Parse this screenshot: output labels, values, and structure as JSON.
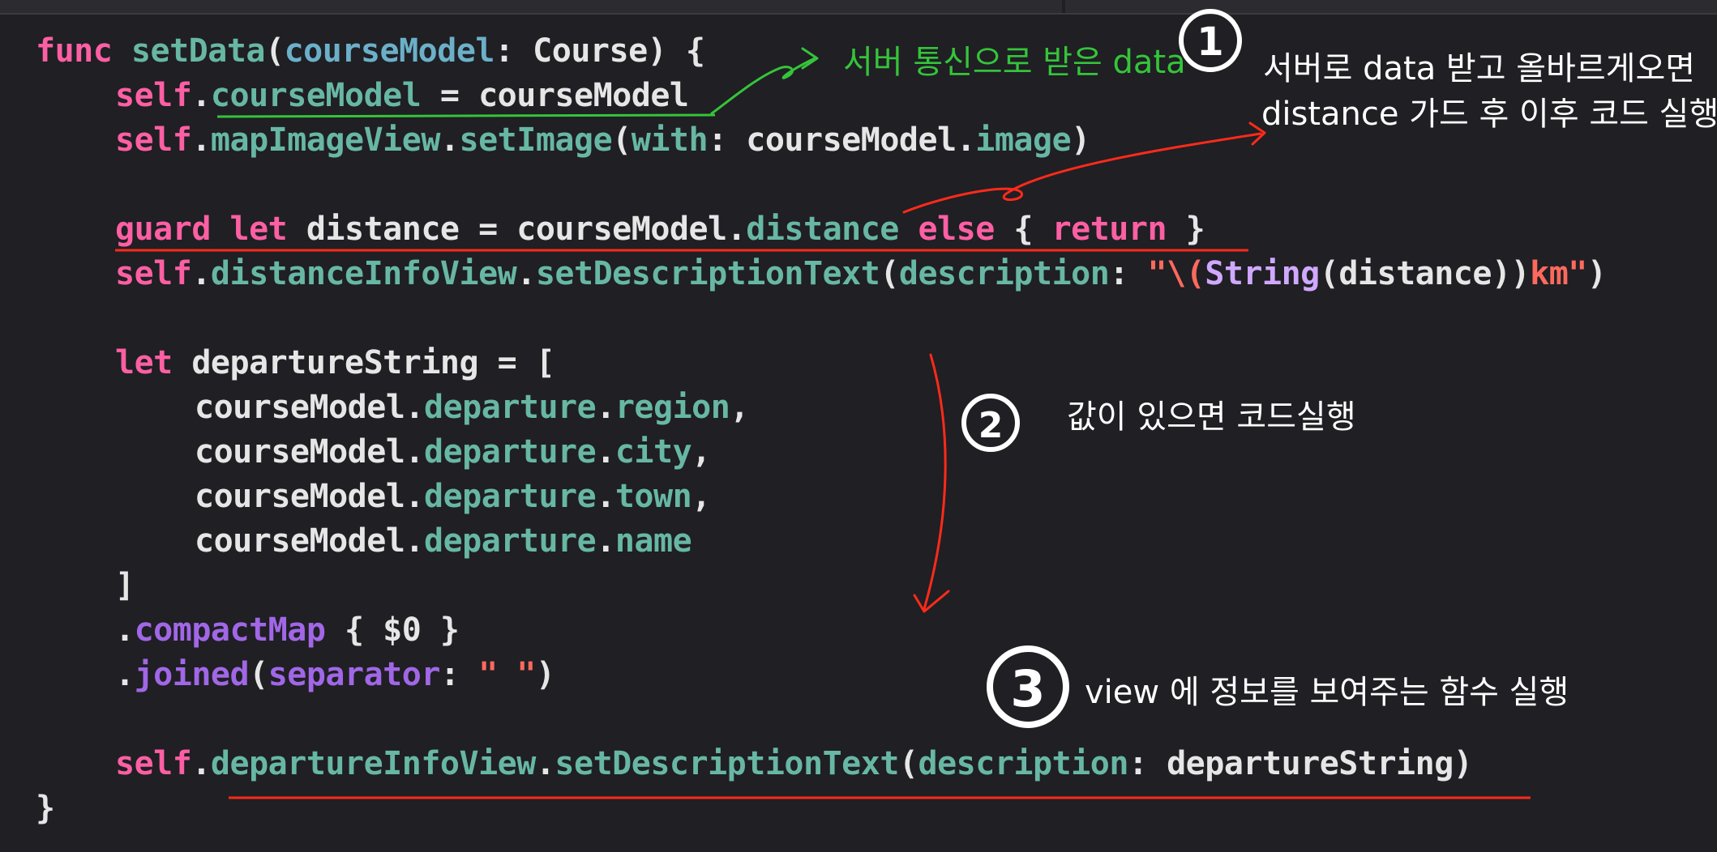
{
  "colors": {
    "background": "#1f1f24",
    "keyword": "#fc5fa3",
    "function": "#67b7a4",
    "type": "#d0a8ff",
    "string": "#fc6a5d",
    "annotation_red": "#ff2a1a",
    "annotation_green": "#35c43a"
  },
  "code": {
    "l1": {
      "kw": "func",
      "name": "setData",
      "open": "(",
      "param": "courseModel",
      "colon": ": ",
      "type": "Course",
      "close": ") {"
    },
    "l2": {
      "kw": "self",
      "dot": ".",
      "prop": "courseModel",
      "rest": " = courseModel"
    },
    "l3": {
      "kw": "self",
      "dot": ".",
      "prop": "mapImageView",
      "dot2": ".",
      "method": "setImage",
      "open": "(",
      "label": "with",
      "mid": ": courseModel.",
      "prop2": "image",
      "close": ")"
    },
    "l4": {
      "kw1": "guard",
      "sp1": " ",
      "kw2": "let",
      "mid": " distance = courseModel.",
      "prop": "distance",
      "sp2": " ",
      "kw3": "else",
      "open": " { ",
      "kw4": "return",
      "close": " }"
    },
    "l5": {
      "kw": "self",
      "dot": ".",
      "prop": "distanceInfoView",
      "dot2": ".",
      "method": "setDescriptionText",
      "open": "(",
      "label": "description",
      "colon": ": ",
      "q": "\"\\(",
      "type": "String",
      "mid": "(distance))",
      "str": "km\"",
      "close": ")"
    },
    "l6": {
      "kw": "let",
      "rest": " departureString = ["
    },
    "l7": {
      "base": "courseModel.",
      "p1": "departure",
      "dot": ".",
      "p2": "region",
      "end": ","
    },
    "l8": {
      "base": "courseModel.",
      "p1": "departure",
      "dot": ".",
      "p2": "city",
      "end": ","
    },
    "l9": {
      "base": "courseModel.",
      "p1": "departure",
      "dot": ".",
      "p2": "town",
      "end": ","
    },
    "l10": {
      "base": "courseModel.",
      "p1": "departure",
      "dot": ".",
      "p2": "name",
      "end": ""
    },
    "l11": {
      "text": "]"
    },
    "l12": {
      "dot": ".",
      "method": "compactMap",
      "rest": " { $0 }"
    },
    "l13": {
      "dot": ".",
      "method": "joined",
      "open": "(",
      "label": "separator",
      "colon": ": ",
      "str": "\" \"",
      "close": ")"
    },
    "l14": {
      "kw": "self",
      "dot": ".",
      "prop": "departureInfoView",
      "dot2": ".",
      "method": "setDescriptionText",
      "open": "(",
      "label": "description",
      "rest": ": departureString)"
    },
    "l15": {
      "text": "}"
    }
  },
  "annotations": {
    "green_note": "서버 통신으로 받은 data",
    "step1_number": "1",
    "step1_line1": "서버로 data 받고 올바르게오면",
    "step1_line2": "distance 가드 후 이후 코드 실행",
    "step2_number": "2",
    "step2_text": "값이 있으면 코드실행",
    "step3_number": "3",
    "step3_text": "view 에 정보를 보여주는 함수 실행"
  }
}
